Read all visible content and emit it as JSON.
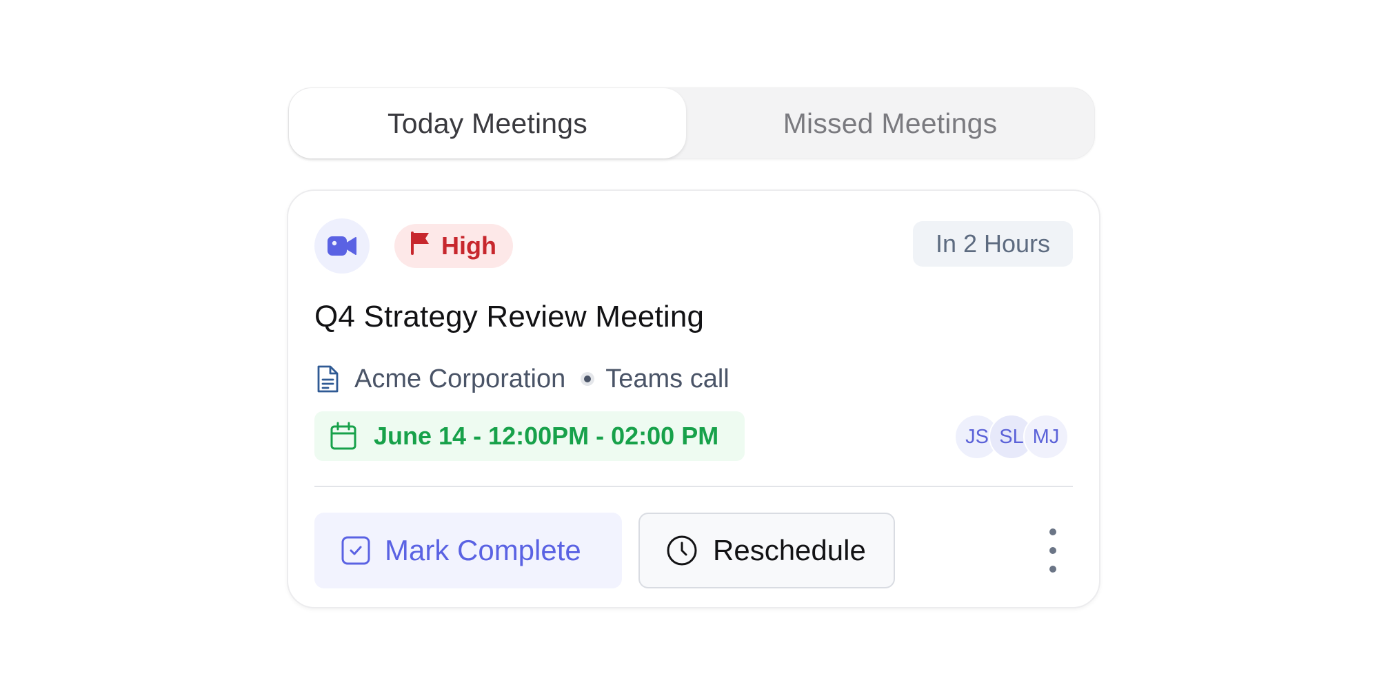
{
  "tabs": [
    {
      "label": "Today Meetings",
      "active": true
    },
    {
      "label": "Missed Meetings",
      "active": false
    }
  ],
  "meeting": {
    "type_icon": "video-camera-icon",
    "priority": {
      "label": "High",
      "icon": "flag-icon",
      "color": "#c7272d"
    },
    "time_until": "In 2 Hours",
    "title": "Q4 Strategy Review Meeting",
    "company": "Acme Corporation",
    "company_icon": "document-icon",
    "call_type": "Teams call",
    "schedule": {
      "text": "June 14 - 12:00PM - 02:00 PM",
      "icon": "calendar-icon",
      "color": "#17a14a"
    },
    "attendees": [
      "JS",
      "SL",
      "MJ"
    ]
  },
  "actions": {
    "complete_label": "Mark Complete",
    "complete_icon": "checkbox-icon",
    "reschedule_label": "Reschedule",
    "reschedule_icon": "clock-icon",
    "more_icon": "more-vertical-icon"
  },
  "colors": {
    "accent": "#5a62e3",
    "priority_high": "#c7272d",
    "date_green": "#17a14a"
  }
}
